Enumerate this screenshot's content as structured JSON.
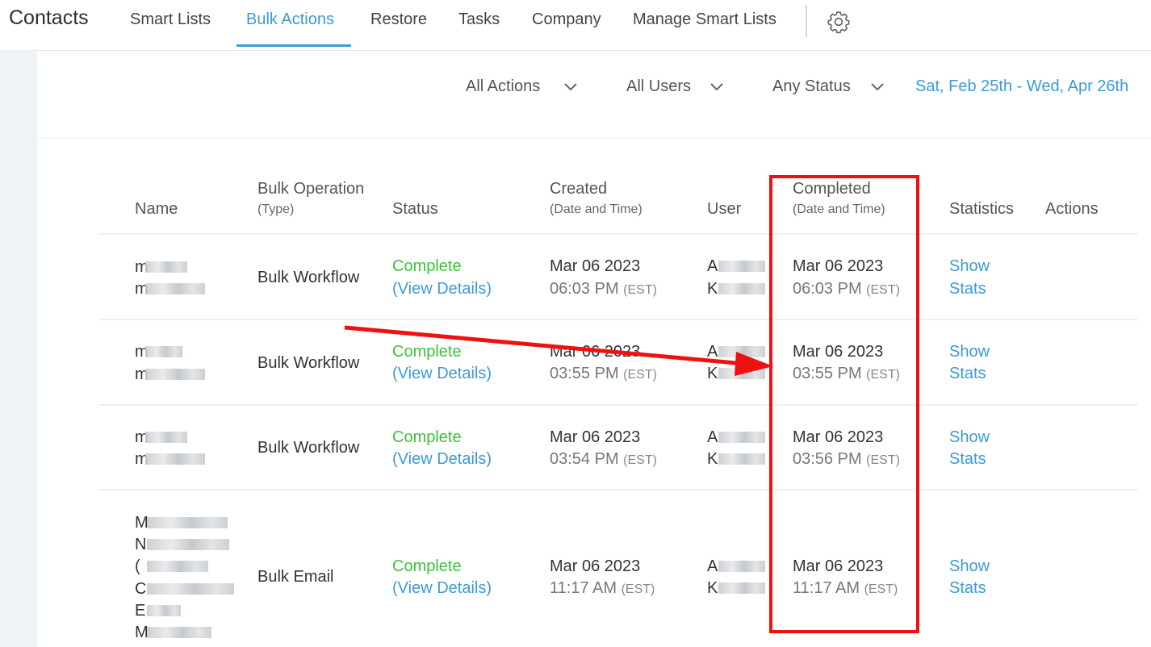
{
  "app": {
    "title": "Contacts"
  },
  "nav": {
    "tabs": [
      {
        "label": "Smart Lists"
      },
      {
        "label": "Bulk Actions"
      },
      {
        "label": "Restore"
      },
      {
        "label": "Tasks"
      },
      {
        "label": "Company"
      },
      {
        "label": "Manage Smart Lists"
      }
    ],
    "active_tab": "Bulk Actions",
    "settings_icon": "gear-icon"
  },
  "filters": {
    "actions": "All Actions",
    "users": "All Users",
    "status": "Any Status",
    "date_range": "Sat, Feb 25th - Wed, Apr 26th"
  },
  "table": {
    "headers": {
      "name": "Name",
      "operation": "Bulk Operation",
      "operation_sub": "(Type)",
      "status": "Status",
      "created": "Created",
      "created_sub": "(Date and Time)",
      "user": "User",
      "completed": "Completed",
      "completed_sub": "(Date and Time)",
      "statistics": "Statistics",
      "actions": "Actions"
    },
    "rows": [
      {
        "name_initials": [
          "m",
          "m"
        ],
        "operation": "Bulk Workflow",
        "status": "Complete",
        "details": "(View Details)",
        "created_date": "Mar 06 2023",
        "created_time": "06:03 PM",
        "created_tz": "(EST)",
        "user_initials": [
          "A",
          "K"
        ],
        "completed_date": "Mar 06 2023",
        "completed_time": "06:03 PM",
        "completed_tz": "(EST)",
        "stats_line1": "Show",
        "stats_line2": "Stats"
      },
      {
        "name_initials": [
          "m",
          "m"
        ],
        "operation": "Bulk Workflow",
        "status": "Complete",
        "details": "(View Details)",
        "created_date": "Mar 06 2023",
        "created_time": "03:55 PM",
        "created_tz": "(EST)",
        "user_initials": [
          "A",
          "K"
        ],
        "completed_date": "Mar 06 2023",
        "completed_time": "03:55 PM",
        "completed_tz": "(EST)",
        "stats_line1": "Show",
        "stats_line2": "Stats"
      },
      {
        "name_initials": [
          "m",
          "m"
        ],
        "operation": "Bulk Workflow",
        "status": "Complete",
        "details": "(View Details)",
        "created_date": "Mar 06 2023",
        "created_time": "03:54 PM",
        "created_tz": "(EST)",
        "user_initials": [
          "A",
          "K"
        ],
        "completed_date": "Mar 06 2023",
        "completed_time": "03:56 PM",
        "completed_tz": "(EST)",
        "stats_line1": "Show",
        "stats_line2": "Stats"
      },
      {
        "name_initials": [
          "M",
          "N",
          "(",
          "C",
          "E",
          "M"
        ],
        "operation": "Bulk Email",
        "status": "Complete",
        "details": "(View Details)",
        "created_date": "Mar 06 2023",
        "created_time": "11:17 AM",
        "created_tz": "(EST)",
        "user_initials": [
          "A",
          "K"
        ],
        "completed_date": "Mar 06 2023",
        "completed_time": "11:17 AM",
        "completed_tz": "(EST)",
        "stats_line1": "Show",
        "stats_line2": "Stats"
      }
    ]
  },
  "annotation": {
    "highlight_color": "#ee1111"
  }
}
